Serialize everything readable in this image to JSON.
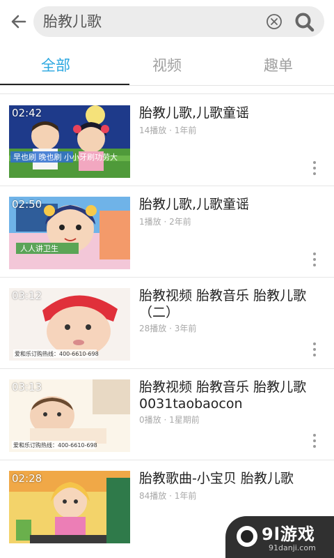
{
  "search": {
    "query": "胎教儿歌"
  },
  "tabs": [
    {
      "label": "全部",
      "active": true
    },
    {
      "label": "视频",
      "active": false
    },
    {
      "label": "趣单",
      "active": false
    }
  ],
  "colors": {
    "accent": "#2aa7e0",
    "text": "#222222",
    "meta": "#a8a8a8"
  },
  "results": [
    {
      "duration": "02:42",
      "title": "胎教儿歌,儿歌童谣",
      "meta": "14播放 · 1年前",
      "thumb_text": "早也刷 晚也刷 小小牙刷功劳大"
    },
    {
      "duration": "02:50",
      "title": "胎教儿歌,儿歌童谣",
      "meta": "1播放 · 2年前",
      "thumb_text": "人人讲卫生"
    },
    {
      "duration": "03:12",
      "title": "胎教视频 胎教音乐 胎教儿歌（二）",
      "meta": "28播放 · 3年前",
      "thumb_text": "爱和乐订购热线：400-6610-698"
    },
    {
      "duration": "03:13",
      "title": "胎教视频 胎教音乐 胎教儿歌0031taobaocon",
      "meta": "0播放 · 1星期前",
      "thumb_text": "爱和乐订购热线：400-6610-698"
    },
    {
      "duration": "02:28",
      "title": "胎教歌曲-小宝贝 胎教儿歌",
      "meta": "84播放 · 1年前",
      "thumb_text": ""
    }
  ],
  "watermark": {
    "brand": "9l游戏",
    "site": "91danji.com"
  },
  "icons": {
    "back": "back-arrow-icon",
    "clear": "clear-circle-icon",
    "search": "search-icon",
    "more": "more-vertical-icon"
  }
}
